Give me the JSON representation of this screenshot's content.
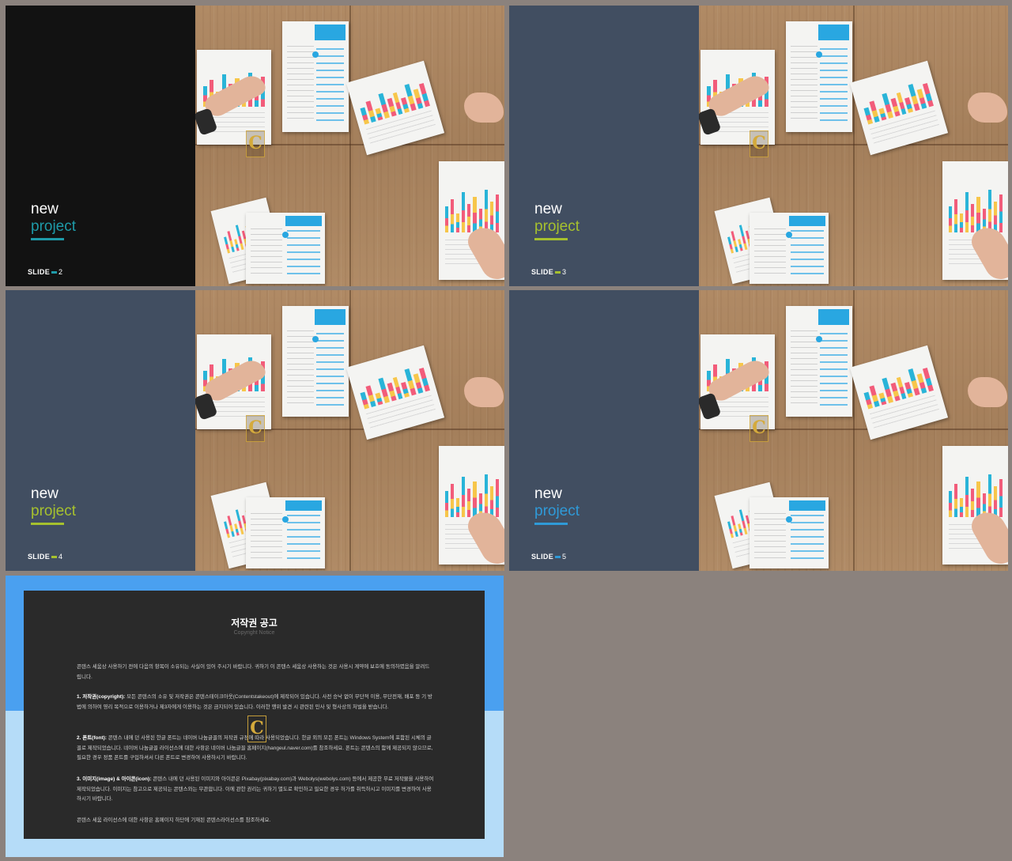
{
  "slides": [
    {
      "id": "slide-2",
      "title_line1": "new",
      "title_line2": "project",
      "slide_label": "SLIDE",
      "slide_number": "2",
      "panel_color": "#121212",
      "accent_color": "#1e9aa8"
    },
    {
      "id": "slide-3",
      "title_line1": "new",
      "title_line2": "project",
      "slide_label": "SLIDE",
      "slide_number": "3",
      "panel_color": "#414e61",
      "accent_color": "#a6c12e"
    },
    {
      "id": "slide-4",
      "title_line1": "new",
      "title_line2": "project",
      "slide_label": "SLIDE",
      "slide_number": "4",
      "panel_color": "#414e61",
      "accent_color": "#a6c12e"
    },
    {
      "id": "slide-5",
      "title_line1": "new",
      "title_line2": "project",
      "slide_label": "SLIDE",
      "slide_number": "5",
      "panel_color": "#414e61",
      "accent_color": "#2f9ad8"
    }
  ],
  "notice": {
    "title": "저작권 공고",
    "subtitle": "Copyright Notice",
    "intro": "콘텐스 세움상 사용하기 전에 다음의 항목이 소유되는 사실이 있어 주시기 바랍니다. 귀하기 이 콘텐스 세움상 사용하는 것은 사용시 계약에 보호에 동의하였음을 알려드립니다.",
    "section1_heading": "1. 저작권(copyright):",
    "section1_body": "모든 콘텐스의 소유 및 저작권은 콘텐스테이크아웃(Contentstakeout)에 제작되어 있습니다. 사전 승낙 없이 무단적 이용, 무단전재, 배포 등 기 방법에 의하여 영리 목적으로 이용하거나 제3자에게 이용하는 것은 금지되어 있습니다. 이러한 행위 발견 시 관련된 민사 및 형사상의 처벌을 받습니다.",
    "section2_heading": "2. 폰트(font):",
    "section2_body": "콘텐스 내에 던 사용된 한글 폰트는 네이버 나눔글꼴의 저작권 규정에 따라 사용되었습니다. 한글 외의 모든 폰트는 Windows System에 포함된 시체의 글꼴로 제작되었습니다. 네이버 나눔글꼴 라이선스에 대한 사항은 네이버 나눔글꼴 홈페이지(hangeul.naver.com)를 참조하세요. 폰트는 콘텐스의 함께 제공되지 않으므로, 필요한 경우 정품 폰트를 구입하셔서 다른 폰트로 변경하여 사용하시기 바랍니다.",
    "section3_heading": "3. 이미지(image) & 아이콘(icon):",
    "section3_body": "콘텐스 내에 던 사용된 이미지와 아이콘은 Pixabay(pixabay.com)과 Webolys(webolys.com) 등에서 제공한 무료 저작물을 사용하여 제작되었습니다. 이미지는 참고으로 제공되는 콘텐스와는 무관합니다. 이에 관한 권리는 귀하기 별도로 확인하고 필요한 경우 허가를 취득하시고 이미지를 변경하여 사용하시기 바랍니다.",
    "outro": "콘텐스 세움 라이선스에 대한 사항은 홈페이지 하단에 기재된 콘텐스라이선스를 참조하세요."
  }
}
